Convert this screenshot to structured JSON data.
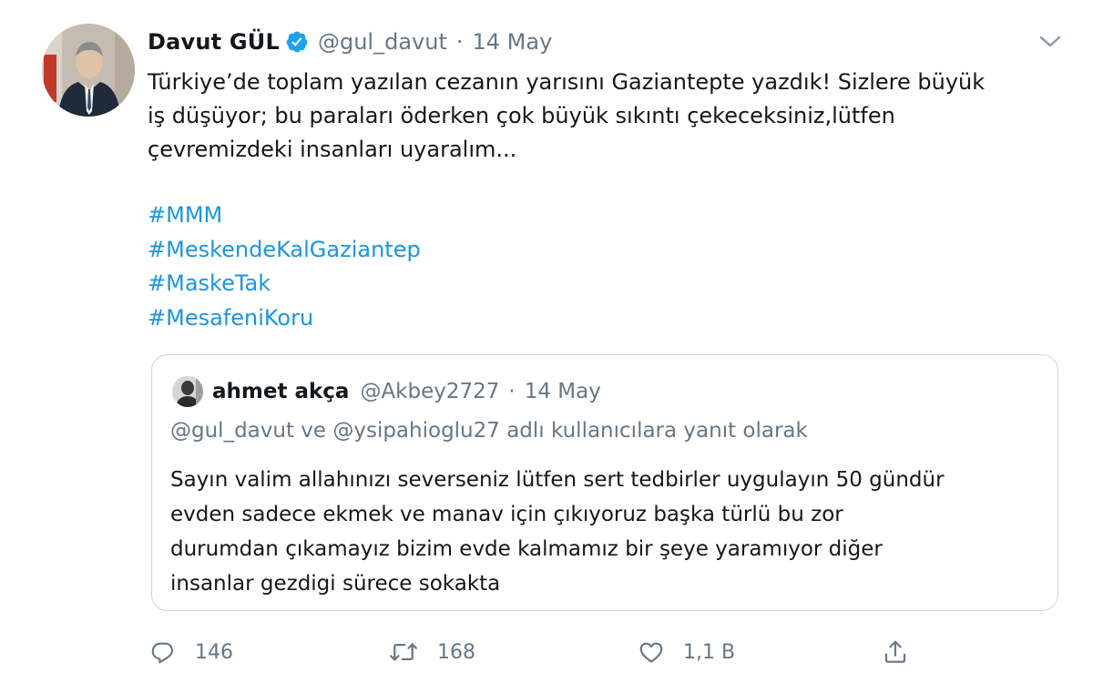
{
  "tweet": {
    "author": {
      "name": "Davut GÜL",
      "handle": "@gul_davut",
      "separator": "·",
      "date": "14 May",
      "verified_icon": "verified-badge-icon",
      "colors": {
        "verified": "#1da1f2"
      }
    },
    "text_lines": [
      "Türkiye’de toplam yazılan cezanın yarısını Gaziantepte yazdık! Sizlere büyük",
      "iş düşüyor; bu paraları öderken çok büyük sıkıntı çekeceksiniz,lütfen",
      "çevremizdeki insanları uyaralım..."
    ],
    "hashtags": [
      "#MMM",
      "#MeskendeKalGaziantep",
      "#MaskeTak",
      "#MesafeniKoru"
    ],
    "quoted": {
      "name": "ahmet akça",
      "handle": "@Akbey2727",
      "separator": "·",
      "date": "14 May",
      "reply_context": "@gul_davut ve @ysipahioglu27 adlı kullanıcılara yanıt olarak",
      "text_lines": [
        "Sayın valim allahınızı severseniz lütfen sert tedbirler uygulayın 50 gündür",
        "evden sadece ekmek ve manav için çıkıyoruz başka türlü bu zor",
        "durumdan çıkamayız bizim evde kalmamız bir şeye  yaramıyor diğer",
        "insanlar gezdigi sürece sokakta"
      ]
    },
    "actions": {
      "reply": {
        "icon": "reply-icon",
        "count": "146"
      },
      "retweet": {
        "icon": "retweet-icon",
        "count": "168"
      },
      "like": {
        "icon": "like-icon",
        "count": "1,1 B"
      },
      "share": {
        "icon": "share-icon"
      }
    },
    "colors": {
      "link": "#1b95e0",
      "muted": "#657786",
      "text": "#14171a",
      "border": "#ccd6dd"
    }
  }
}
